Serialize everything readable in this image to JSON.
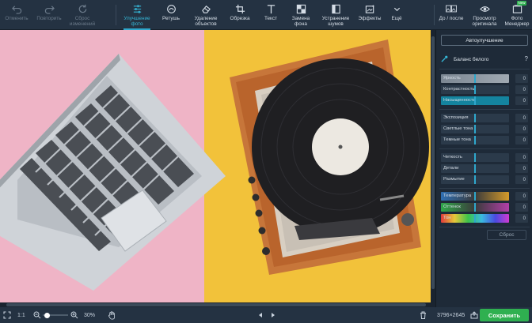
{
  "toolbar": {
    "undo": "Отменить",
    "redo": "Повторить",
    "reset_changes": "Сброс\nизменений",
    "tools": [
      {
        "label": "Улучшение\nфото",
        "icon": "sliders-icon"
      },
      {
        "label": "Ретушь",
        "icon": "retouch-icon"
      },
      {
        "label": "Удаление\nобъектов",
        "icon": "eraser-icon"
      },
      {
        "label": "Обрезка",
        "icon": "crop-icon"
      },
      {
        "label": "Текст",
        "icon": "text-icon"
      },
      {
        "label": "Замена\nфона",
        "icon": "background-icon"
      },
      {
        "label": "Устранение\nшумов",
        "icon": "noise-icon"
      },
      {
        "label": "Эффекты",
        "icon": "effects-icon"
      },
      {
        "label": "Ещё",
        "icon": "chevron-down-icon"
      }
    ],
    "before_after": "До / после",
    "view_original": "Просмотр\nоригинала",
    "photo_manager": "Фото\nМенеджер",
    "new_badge": "New"
  },
  "panel": {
    "auto_button": "Автоулучшение",
    "white_balance": "Баланс белого",
    "help": "?",
    "groups": [
      [
        {
          "label": "Яркость",
          "value": "0",
          "style": "gray"
        },
        {
          "label": "Контрастность",
          "value": "0",
          "style": "dark"
        },
        {
          "label": "Насыщенность",
          "value": "0",
          "style": "teal"
        }
      ],
      [
        {
          "label": "Экспозиция",
          "value": "0",
          "style": "dark"
        },
        {
          "label": "Светлые тона",
          "value": "0",
          "style": "dark"
        },
        {
          "label": "Темные тона",
          "value": "0",
          "style": "dark"
        }
      ],
      [
        {
          "label": "Четкость",
          "value": "0",
          "style": "dark"
        },
        {
          "label": "Детали",
          "value": "0",
          "style": "dark"
        },
        {
          "label": "Размытие",
          "value": "0",
          "style": "dark"
        }
      ],
      [
        {
          "label": "Температура",
          "value": "0",
          "style": "temp"
        },
        {
          "label": "Оттенок",
          "value": "0",
          "style": "tint"
        },
        {
          "label": "Тон",
          "value": "0",
          "style": "hue"
        }
      ]
    ],
    "reset": "Сброс"
  },
  "bottom": {
    "one_to_one": "1:1",
    "zoom_level": "30%",
    "dimensions": "3796×2645",
    "save": "Сохранить"
  },
  "colors": {
    "accent": "#2ea7cc",
    "save": "#2fb050",
    "pink": "#efb4c6",
    "yellow": "#f2c23a"
  }
}
